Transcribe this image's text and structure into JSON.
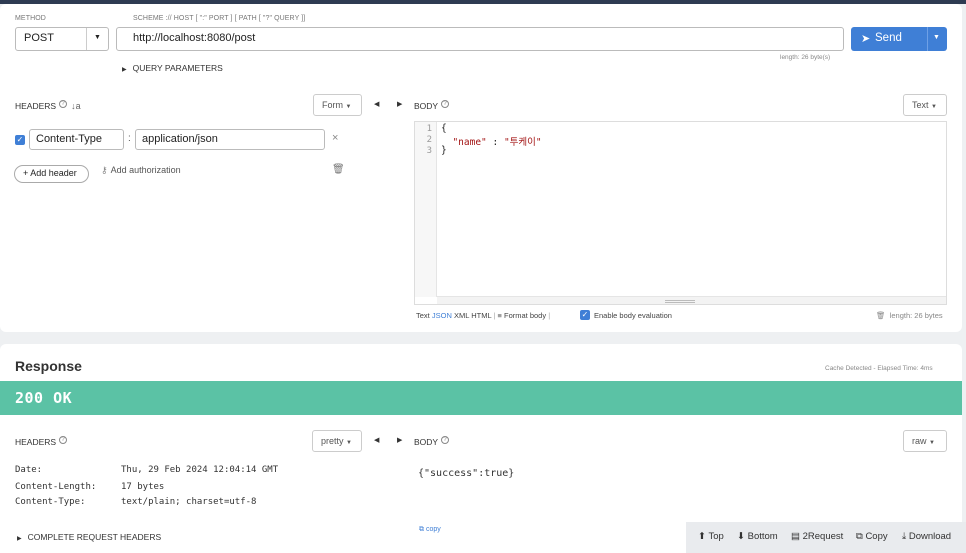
{
  "request": {
    "method_label": "METHOD",
    "method_value": "POST",
    "url_label": "SCHEME :// HOST [ \":\" PORT ] [ PATH [ \"?\" QUERY ]]",
    "url_value": "http://localhost:8080/post",
    "send_label": "Send",
    "length_info": "length: 26 byte(s)",
    "query_parameters_label": "QUERY PARAMETERS",
    "headers_title": "HEADERS",
    "headers_mode": "Form",
    "header_rows": [
      {
        "name": "Content-Type",
        "value": "application/json",
        "enabled": true
      }
    ],
    "add_header_label": "+ Add header",
    "add_authorization_label": "Add authorization",
    "body_title": "BODY",
    "body_type": "Text",
    "body_lines": [
      "1",
      "2",
      "3"
    ],
    "body_code": {
      "line1": "{",
      "key": "\"name\"",
      "colon": " : ",
      "value": "\"투케이\"",
      "line3": "}"
    },
    "body_formats": {
      "text": "Text",
      "json": "JSON",
      "xml": "XML",
      "html": "HTML"
    },
    "format_body_label": "Format body",
    "enable_eval_label": "Enable body evaluation",
    "body_length": "length: 26 bytes"
  },
  "response": {
    "title": "Response",
    "cache_info": "Cache Detected - Elapsed Time: 4ms",
    "status": "200 OK",
    "headers_title": "HEADERS",
    "headers_mode": "pretty",
    "headers": [
      {
        "name": "Date:",
        "value": "Thu, 29 Feb 2024 12:04:14 GMT"
      },
      {
        "name": "Content-Length:",
        "value": "17 bytes"
      },
      {
        "name": "Content-Type:",
        "value": "text/plain; charset=utf-8"
      }
    ],
    "complete_headers_label": "COMPLETE REQUEST HEADERS",
    "body_title": "BODY",
    "body_mode": "raw",
    "body_content": "{\"success\":true}",
    "copy_label": "copy"
  },
  "footer": {
    "top": "Top",
    "bottom": "Bottom",
    "to_request": "2Request",
    "copy": "Copy",
    "download": "Download"
  },
  "colors": {
    "accent": "#3f7fd6",
    "status_ok": "#5bc2a5"
  }
}
